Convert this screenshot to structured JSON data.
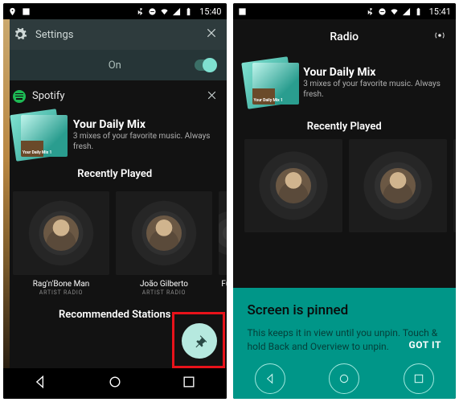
{
  "left": {
    "status": {
      "time": "15:40"
    },
    "qs": {
      "settings_label": "Settings",
      "on_label": "On"
    },
    "notif": {
      "app_name": "Spotify",
      "daily_mix": {
        "title": "Your Daily Mix",
        "subtitle": "3 mixes of your favorite music. Always fresh.",
        "art_label": "Your Daily Mix 1"
      },
      "recently_played_title": "Recently Played",
      "cards": [
        {
          "label": "Rag'n'Bone Man",
          "sub": "ARTIST RADIO"
        },
        {
          "label": "João Gilberto",
          "sub": "ARTIST RADIO"
        },
        {
          "label": "Fuert",
          "sub": "PL"
        }
      ],
      "recommended_title": "Recommended Stations"
    }
  },
  "right": {
    "status": {
      "time": "15:41"
    },
    "appbar_title": "Radio",
    "daily_mix": {
      "title": "Your Daily Mix",
      "subtitle": "3 mixes of your favorite music. Always fresh.",
      "art_label": "Your Daily Mix 1"
    },
    "recently_played_title": "Recently Played",
    "pin_sheet": {
      "heading": "Screen is pinned",
      "body": "This keeps it in view until you unpin. Touch & hold Back and Overview to unpin.",
      "action": "GOT IT"
    }
  }
}
